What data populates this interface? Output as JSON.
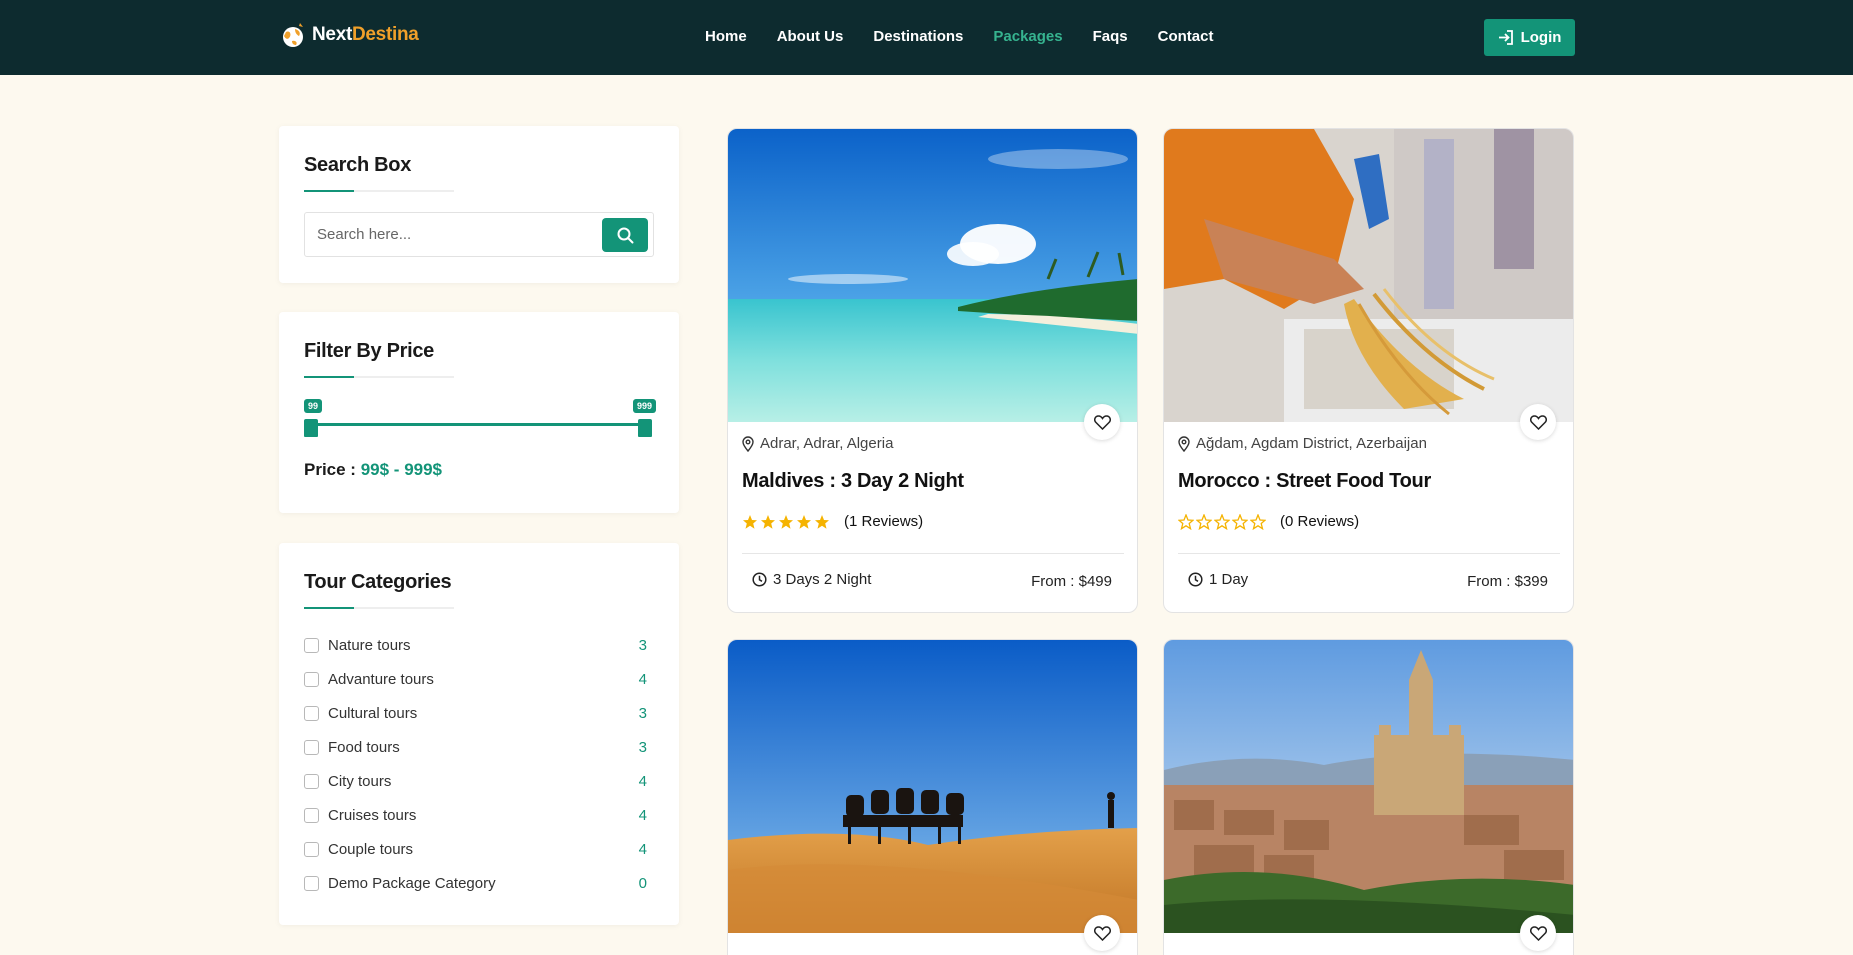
{
  "header": {
    "logo": {
      "part1": "Next",
      "part2": "Destina"
    },
    "nav": [
      "Home",
      "About Us",
      "Destinations",
      "Packages",
      "Faqs",
      "Contact"
    ],
    "active_nav": "Packages",
    "login_label": "Login"
  },
  "sidebar": {
    "search": {
      "title": "Search Box",
      "placeholder": "Search here..."
    },
    "price_filter": {
      "title": "Filter By Price",
      "min": "99",
      "max": "999",
      "price_label": "Price :",
      "price_value": "99$ - 999$"
    },
    "categories": {
      "title": "Tour Categories",
      "items": [
        {
          "label": "Nature tours",
          "count": "3"
        },
        {
          "label": "Advanture tours",
          "count": "4"
        },
        {
          "label": "Cultural tours",
          "count": "3"
        },
        {
          "label": "Food tours",
          "count": "3"
        },
        {
          "label": "City tours",
          "count": "4"
        },
        {
          "label": "Cruises tours",
          "count": "4"
        },
        {
          "label": "Couple tours",
          "count": "4"
        },
        {
          "label": "Demo Package Category",
          "count": "0"
        }
      ]
    }
  },
  "packages": [
    {
      "location": "Adrar, Adrar, Algeria",
      "title": "Maldives : 3 Day 2 Night",
      "stars": 5,
      "reviews": "(1 Reviews)",
      "duration": "3 Days 2 Night",
      "price": "From : $499",
      "image": "tropical-beach-photo"
    },
    {
      "location": "Ağdam, Agdam District, Azerbaijan",
      "title": "Morocco : Street Food Tour",
      "stars": 0,
      "reviews": "(0 Reviews)",
      "duration": "1 Day",
      "price": "From : $399",
      "image": "street-food-photo"
    },
    {
      "image": "desert-camel-caravan-photo"
    },
    {
      "image": "historic-city-cathedral-photo"
    }
  ],
  "colors": {
    "accent": "#139478",
    "header_bg": "#0d2b2f",
    "page_bg": "#fdf9ef",
    "star": "#f5b301",
    "logo_orange": "#f0a02a"
  }
}
